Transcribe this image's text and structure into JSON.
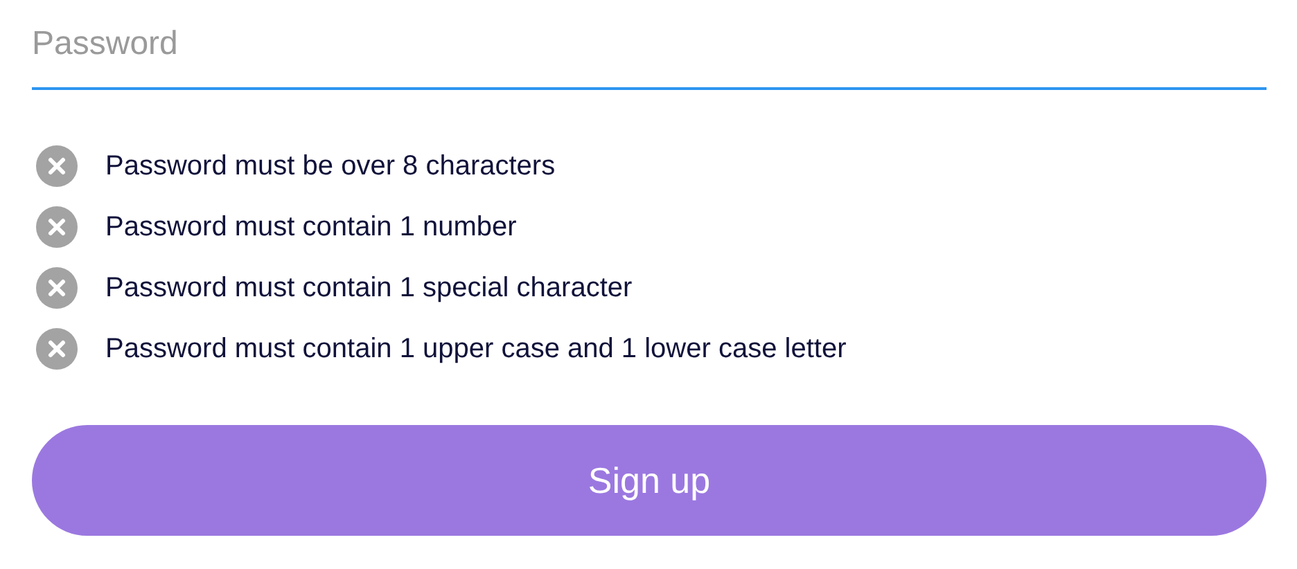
{
  "password_field": {
    "placeholder": "Password",
    "focused": true
  },
  "rules": [
    {
      "text": "Password must be over 8 characters",
      "met": false
    },
    {
      "text": "Password must contain 1 number",
      "met": false
    },
    {
      "text": "Password must contain 1 special character",
      "met": false
    },
    {
      "text": "Password must contain 1 upper case and 1 lower case letter",
      "met": false
    }
  ],
  "submit_button": {
    "label": "Sign up"
  }
}
